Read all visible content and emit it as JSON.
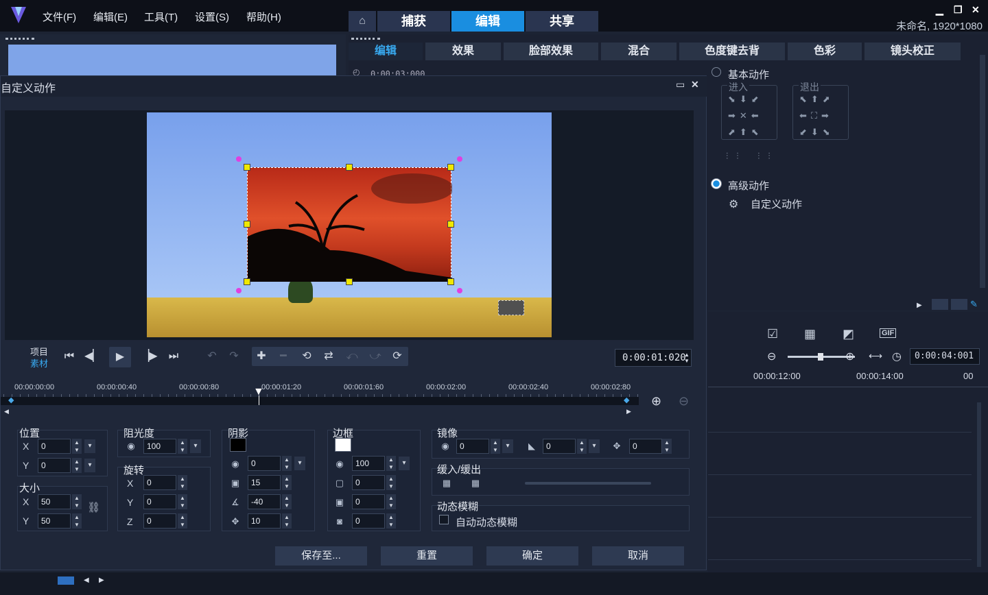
{
  "menu": {
    "file": "文件(F)",
    "edit": "编辑(E)",
    "tools": "工具(T)",
    "settings": "设置(S)",
    "help": "帮助(H)"
  },
  "phase_tabs": {
    "capture": "捕获",
    "edit": "编辑",
    "share": "共享"
  },
  "project_info": "未命名, 1920*1080",
  "edit_tabs": [
    "编辑",
    "效果",
    "脸部效果",
    "混合",
    "色度键去背",
    "色彩",
    "镜头校正"
  ],
  "timeline_top_time": "0:00:03:000",
  "motion": {
    "basic": "基本动作",
    "enter": "进入",
    "exit": "退出",
    "advanced": "高级动作",
    "custom": "自定义动作"
  },
  "right_timecode": "0:00:04:001",
  "right_ruler": [
    "00:00:12:00",
    "00:00:14:00",
    "00"
  ],
  "dialog": {
    "title": "自定义动作",
    "project_label": "项目",
    "clip_label": "素材",
    "timecode": "0:00:01:020",
    "ruler": [
      "00:00:00:00",
      "00:00:00:40",
      "00:00:00:80",
      "00:00:01:20",
      "00:00:01:60",
      "00:00:02:00",
      "00:00:02:40",
      "00:00:02:80"
    ],
    "position": {
      "label": "位置",
      "x_label": "X",
      "y_label": "Y",
      "x": "0",
      "y": "0"
    },
    "size": {
      "label": "大小",
      "x_label": "X",
      "y_label": "Y",
      "x": "50",
      "y": "50"
    },
    "opacity": {
      "label": "阻光度",
      "value": "100"
    },
    "rotation": {
      "label": "旋转",
      "x_label": "X",
      "y_label": "Y",
      "z_label": "Z",
      "x": "0",
      "y": "0",
      "z": "0"
    },
    "shadow": {
      "label": "阴影",
      "color": "#000000",
      "opacity": "0",
      "blur": "15",
      "angle": "-40",
      "distance": "10"
    },
    "border": {
      "label": "边框",
      "color": "#ffffff",
      "opacity": "100",
      "width": "0",
      "v1": "0",
      "v2": "0"
    },
    "mirror": {
      "label": "镜像",
      "v1": "0",
      "v2": "0",
      "v3": "0"
    },
    "ease": {
      "label": "缓入/缓出"
    },
    "motion_blur": {
      "label": "动态模糊",
      "auto": "自动动态模糊"
    },
    "buttons": {
      "save": "保存至...",
      "reset": "重置",
      "ok": "确定",
      "cancel": "取消"
    }
  },
  "colors": {
    "accent": "#1a8ee0",
    "handle": "#f0e800",
    "rotate_handle": "#e040e0"
  }
}
